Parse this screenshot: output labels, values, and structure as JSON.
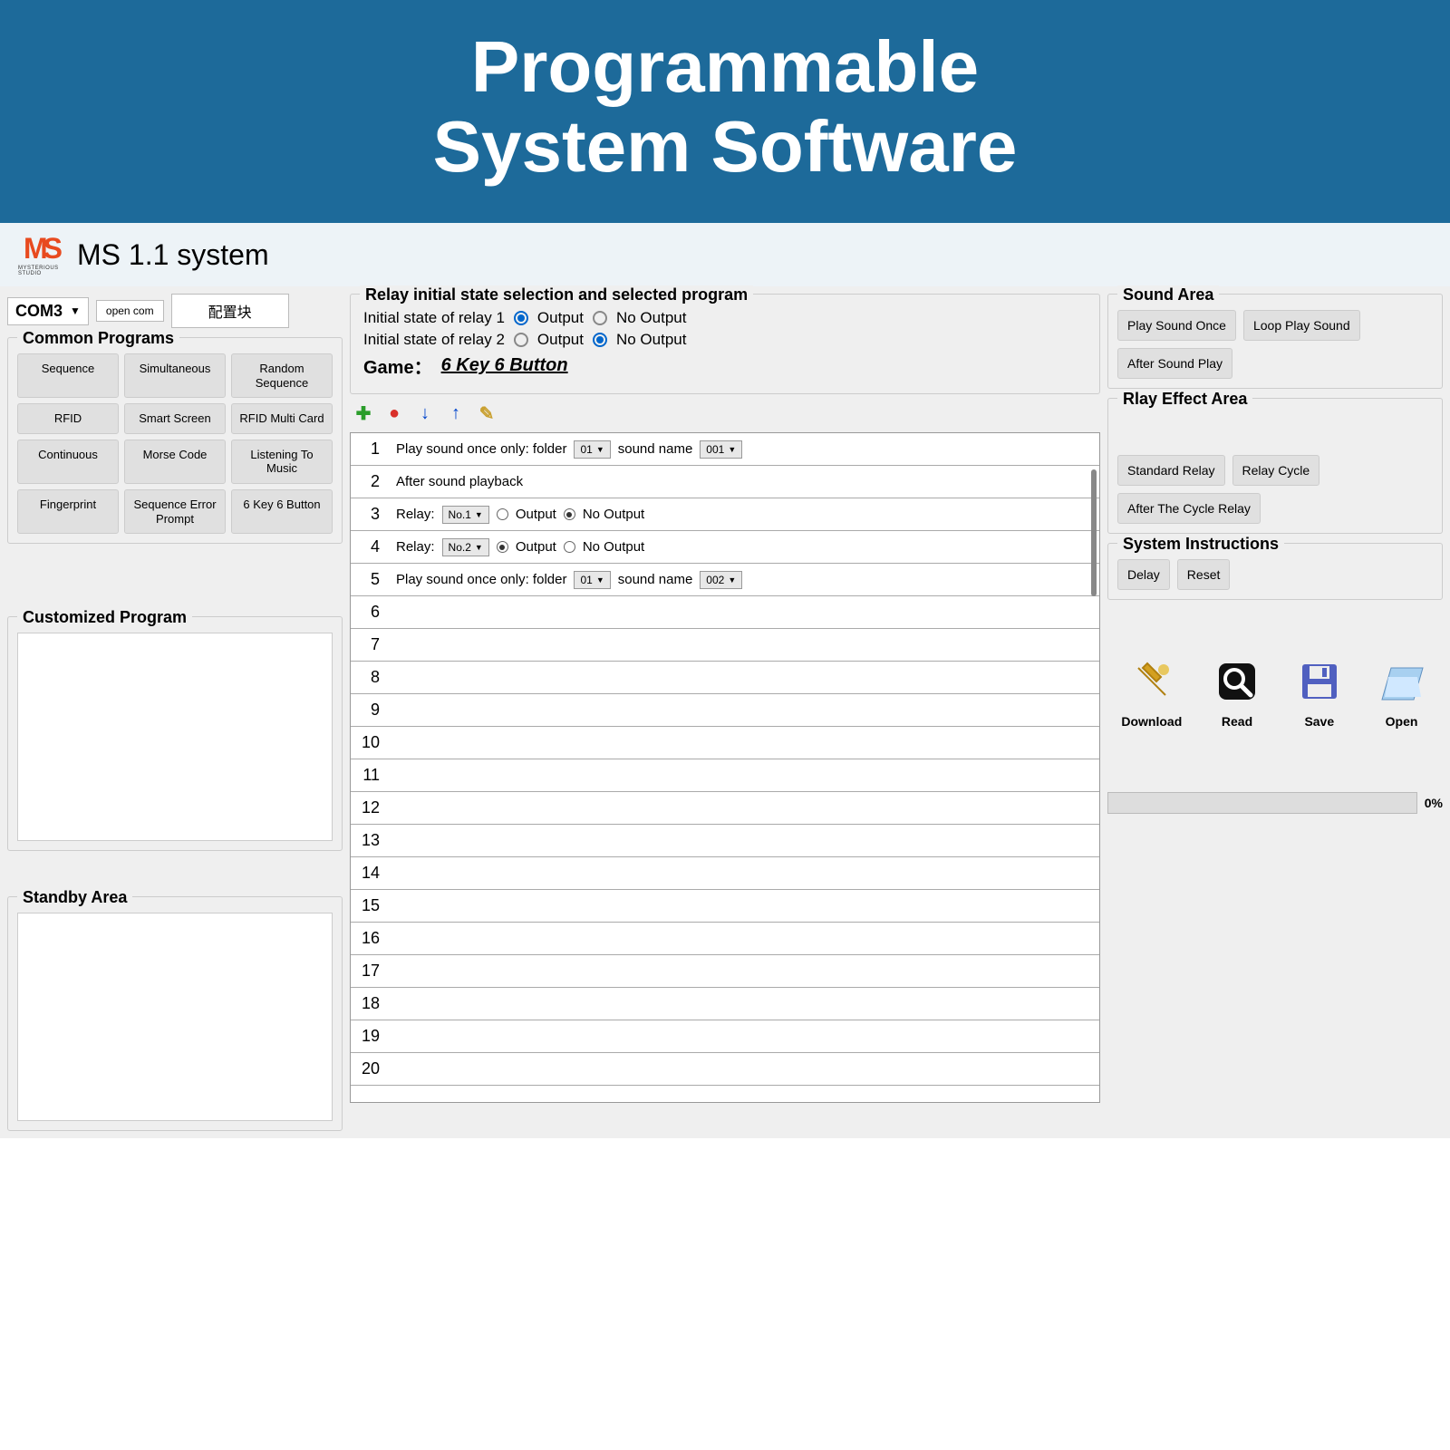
{
  "banner": {
    "line1": "Programmable",
    "line2": "System Software"
  },
  "titlebar": {
    "logo_text": "MYSTERIOUS STUDIO",
    "title": "MS 1.1 system"
  },
  "top_controls": {
    "com_port": "COM3",
    "open_com": "open com",
    "config_block": "配置块"
  },
  "common_programs": {
    "title": "Common Programs",
    "items": [
      "Sequence",
      "Simultaneous",
      "Random Sequence",
      "RFID",
      "Smart Screen",
      "RFID Multi Card",
      "Continuous",
      "Morse Code",
      "Listening To Music",
      "Fingerprint",
      "Sequence Error Prompt",
      "6 Key 6 Button"
    ]
  },
  "customized_program": {
    "title": "Customized Program"
  },
  "standby_area": {
    "title": "Standby Area"
  },
  "relay_panel": {
    "title": "Relay initial state selection and selected program",
    "relay1_label": "Initial state of relay 1",
    "relay2_label": "Initial state of relay 2",
    "output": "Output",
    "no_output": "No Output",
    "game_label": "Game：",
    "game_value": "6 Key 6 Button"
  },
  "steps": {
    "count": 20,
    "row1": {
      "text1": "Play sound once only: folder",
      "folder": "01",
      "text2": "sound name",
      "sound": "001"
    },
    "row2": {
      "text": "After sound playback"
    },
    "row3": {
      "label": "Relay:",
      "num": "No.1",
      "output": "Output",
      "no_output": "No Output"
    },
    "row4": {
      "label": "Relay:",
      "num": "No.2",
      "output": "Output",
      "no_output": "No Output"
    },
    "row5": {
      "text1": "Play sound once only: folder",
      "folder": "01",
      "text2": "sound name",
      "sound": "002"
    }
  },
  "sound_area": {
    "title": "Sound Area",
    "buttons": [
      "Play Sound Once",
      "Loop Play Sound",
      "After Sound Play"
    ]
  },
  "relay_effect": {
    "title": "Rlay Effect Area",
    "buttons": [
      "Standard Relay",
      "Relay Cycle",
      "After The Cycle Relay"
    ]
  },
  "system_instructions": {
    "title": "System Instructions",
    "buttons": [
      "Delay",
      "Reset"
    ]
  },
  "actions": {
    "download": "Download",
    "read": "Read",
    "save": "Save",
    "open": "Open"
  },
  "progress": {
    "percent": "0%"
  }
}
